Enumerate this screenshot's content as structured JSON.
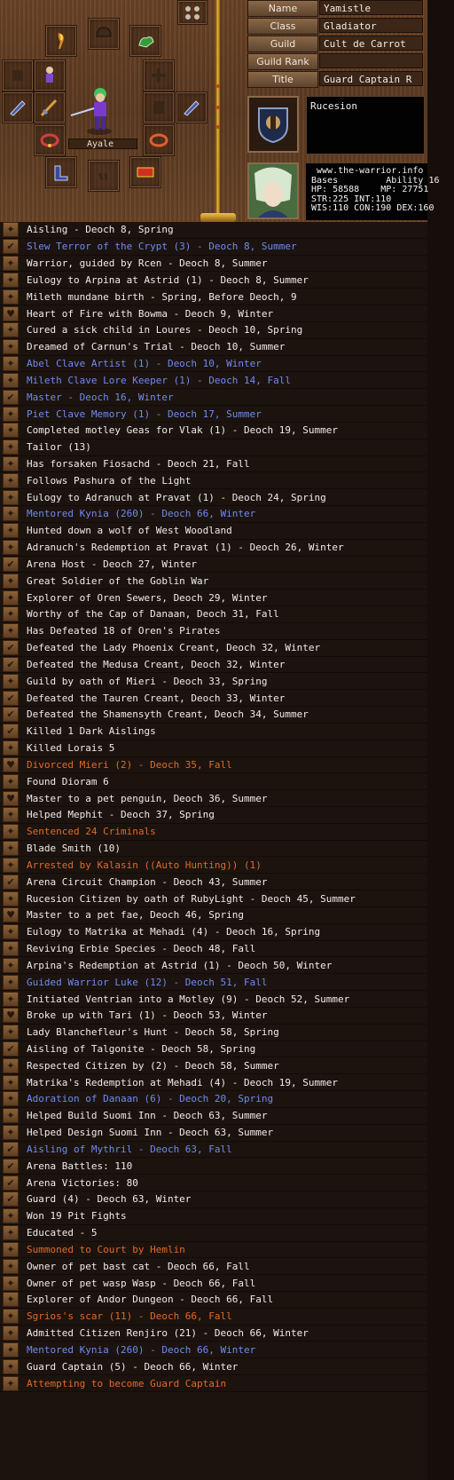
{
  "character": {
    "fields": [
      {
        "label": "Name",
        "value": "Yamistle"
      },
      {
        "label": "Class",
        "value": "Gladiator"
      },
      {
        "label": "Guild",
        "value": "Cult de Carrot"
      },
      {
        "label": "Guild Rank",
        "value": ""
      },
      {
        "label": "Title",
        "value": "Guard Captain R"
      }
    ],
    "nation": "Rucesion",
    "name_tag": "Ayale",
    "stats_lines": [
      " www.the-warrior.info",
      "Bases         Ability 16",
      "HP: 58588    MP: 27751",
      "STR:225 INT:110",
      "WIS:110 CON:190 DEX:160"
    ]
  },
  "colors": {
    "white": "#f0ece8",
    "blue": "#6e8cf0",
    "orange": "#e06a2a"
  },
  "legend": [
    {
      "mark": "wing",
      "color": "white",
      "text": "Aisling - Deoch 8, Spring"
    },
    {
      "mark": "check",
      "color": "blue",
      "text": "Slew Terror of the Crypt (3) - Deoch 8, Summer"
    },
    {
      "mark": "wing",
      "color": "white",
      "text": "Warrior, guided by Rcen - Deoch 8, Summer"
    },
    {
      "mark": "wing",
      "color": "white",
      "text": "Eulogy to Arpina at Astrid (1) - Deoch 8, Summer"
    },
    {
      "mark": "wing",
      "color": "white",
      "text": "Mileth mundane birth - Spring, Before Deoch, 9"
    },
    {
      "mark": "heart",
      "color": "white",
      "text": "Heart of Fire with Bowma - Deoch 9, Winter"
    },
    {
      "mark": "wing",
      "color": "white",
      "text": "Cured a sick child in Loures - Deoch 10, Spring"
    },
    {
      "mark": "wing",
      "color": "white",
      "text": "Dreamed of Carnun's Trial - Deoch 10, Summer"
    },
    {
      "mark": "wing",
      "color": "blue",
      "text": "Abel Clave Artist (1) - Deoch 10, Winter"
    },
    {
      "mark": "wing",
      "color": "blue",
      "text": "Mileth Clave Lore Keeper (1) - Deoch 14, Fall"
    },
    {
      "mark": "check",
      "color": "blue",
      "text": "Master - Deoch 16, Winter"
    },
    {
      "mark": "wing",
      "color": "blue",
      "text": "Piet Clave Memory (1) - Deoch 17, Summer"
    },
    {
      "mark": "wing",
      "color": "white",
      "text": "Completed motley Geas for Vlak (1) - Deoch 19, Summer"
    },
    {
      "mark": "wing",
      "color": "white",
      "text": "Tailor (13)"
    },
    {
      "mark": "wing",
      "color": "white",
      "text": "Has forsaken Fiosachd - Deoch 21, Fall"
    },
    {
      "mark": "wing",
      "color": "white",
      "text": "Follows Pashura of the Light"
    },
    {
      "mark": "wing",
      "color": "white",
      "text": "Eulogy to Adranuch at Pravat (1) - Deoch 24, Spring"
    },
    {
      "mark": "wing",
      "color": "blue",
      "text": "Mentored Kynia (260) - Deoch 66, Winter"
    },
    {
      "mark": "wing",
      "color": "white",
      "text": "Hunted down a wolf of West Woodland"
    },
    {
      "mark": "wing",
      "color": "white",
      "text": "Adranuch's Redemption at Pravat (1) - Deoch 26, Winter"
    },
    {
      "mark": "check",
      "color": "white",
      "text": "Arena Host - Deoch 27, Winter"
    },
    {
      "mark": "wing",
      "color": "white",
      "text": "Great Soldier of the Goblin War"
    },
    {
      "mark": "wing",
      "color": "white",
      "text": "Explorer of Oren Sewers, Deoch 29, Winter"
    },
    {
      "mark": "wing",
      "color": "white",
      "text": "Worthy of the Cap of Danaan, Deoch 31, Fall"
    },
    {
      "mark": "wing",
      "color": "white",
      "text": "Has Defeated 18 of Oren's Pirates"
    },
    {
      "mark": "check",
      "color": "white",
      "text": "Defeated the Lady Phoenix Creant, Deoch 32, Winter"
    },
    {
      "mark": "check",
      "color": "white",
      "text": "Defeated the Medusa Creant, Deoch 32, Winter"
    },
    {
      "mark": "wing",
      "color": "white",
      "text": "Guild by oath of Mieri - Deoch 33, Spring"
    },
    {
      "mark": "check",
      "color": "white",
      "text": "Defeated the Tauren Creant, Deoch 33, Winter"
    },
    {
      "mark": "check",
      "color": "white",
      "text": "Defeated the Shamensyth Creant, Deoch 34, Summer"
    },
    {
      "mark": "check",
      "color": "white",
      "text": "Killed 1 Dark Aislings"
    },
    {
      "mark": "wing",
      "color": "white",
      "text": "Killed Lorais 5"
    },
    {
      "mark": "heart",
      "color": "orange",
      "text": "Divorced Mieri (2) - Deoch 35, Fall"
    },
    {
      "mark": "wing",
      "color": "white",
      "text": "Found Dioram 6"
    },
    {
      "mark": "heart",
      "color": "white",
      "text": "Master to a pet penguin, Deoch 36, Summer"
    },
    {
      "mark": "wing",
      "color": "white",
      "text": "Helped Mephit - Deoch 37, Spring"
    },
    {
      "mark": "wing",
      "color": "orange",
      "text": "Sentenced 24 Criminals"
    },
    {
      "mark": "wing",
      "color": "white",
      "text": "Blade Smith (10)"
    },
    {
      "mark": "wing",
      "color": "orange",
      "text": "Arrested by Kalasin ((Auto Hunting)) (1)"
    },
    {
      "mark": "check",
      "color": "white",
      "text": "Arena Circuit Champion - Deoch 43, Summer"
    },
    {
      "mark": "wing",
      "color": "white",
      "text": "Rucesion Citizen by oath of RubyLight - Deoch 45, Summer"
    },
    {
      "mark": "heart",
      "color": "white",
      "text": "Master to a pet fae, Deoch 46, Spring"
    },
    {
      "mark": "wing",
      "color": "white",
      "text": "Eulogy to Matrika at Mehadi (4) - Deoch 16, Spring"
    },
    {
      "mark": "wing",
      "color": "white",
      "text": "Reviving Erbie Species - Deoch 48, Fall"
    },
    {
      "mark": "wing",
      "color": "white",
      "text": "Arpina's Redemption at Astrid (1) - Deoch 50, Winter"
    },
    {
      "mark": "wing",
      "color": "blue",
      "text": "Guided Warrior Luke (12) - Deoch 51, Fall"
    },
    {
      "mark": "wing",
      "color": "white",
      "text": "Initiated Ventrian into a Motley (9) - Deoch 52, Summer"
    },
    {
      "mark": "heart",
      "color": "white",
      "text": "Broke up with Tari (1) - Deoch 53, Winter"
    },
    {
      "mark": "wing",
      "color": "white",
      "text": "Lady Blanchefleur's Hunt - Deoch 58, Spring"
    },
    {
      "mark": "check",
      "color": "white",
      "text": "Aisling of Talgonite - Deoch 58, Spring"
    },
    {
      "mark": "wing",
      "color": "white",
      "text": "Respected Citizen by  (2) - Deoch 58, Summer"
    },
    {
      "mark": "wing",
      "color": "white",
      "text": "Matrika's Redemption at Mehadi (4) - Deoch 19, Summer"
    },
    {
      "mark": "wing",
      "color": "blue",
      "text": "Adoration of Danaan (6) - Deoch 20, Spring"
    },
    {
      "mark": "wing",
      "color": "white",
      "text": "Helped Build Suomi Inn - Deoch 63, Summer"
    },
    {
      "mark": "wing",
      "color": "white",
      "text": "Helped Design Suomi Inn - Deoch 63, Summer"
    },
    {
      "mark": "check",
      "color": "blue",
      "text": "Aisling of Mythril - Deoch 63, Fall"
    },
    {
      "mark": "check",
      "color": "white",
      "text": "Arena Battles: 110"
    },
    {
      "mark": "check",
      "color": "white",
      "text": "Arena Victories: 80"
    },
    {
      "mark": "check",
      "color": "white",
      "text": "Guard (4) - Deoch 63, Winter"
    },
    {
      "mark": "wing",
      "color": "white",
      "text": "Won 19 Pit Fights"
    },
    {
      "mark": "wing",
      "color": "white",
      "text": "Educated - 5"
    },
    {
      "mark": "wing",
      "color": "orange",
      "text": "Summoned to Court by Hemlin"
    },
    {
      "mark": "wing",
      "color": "white",
      "text": "Owner of pet bast cat - Deoch 66, Fall"
    },
    {
      "mark": "wing",
      "color": "white",
      "text": "Owner of pet wasp Wasp - Deoch 66, Fall"
    },
    {
      "mark": "wing",
      "color": "white",
      "text": "Explorer of Andor Dungeon - Deoch 66, Fall"
    },
    {
      "mark": "wing",
      "color": "orange",
      "text": "Sgrios's scar (11) - Deoch 66, Fall"
    },
    {
      "mark": "wing",
      "color": "white",
      "text": "Admitted Citizen Renjiro (21) - Deoch 66, Winter"
    },
    {
      "mark": "wing",
      "color": "blue",
      "text": "Mentored Kynia (260) - Deoch 66, Winter"
    },
    {
      "mark": "wing",
      "color": "white",
      "text": "Guard Captain (5) - Deoch 66, Winter"
    },
    {
      "mark": "wing",
      "color": "orange",
      "text": "Attempting to become Guard Captain"
    }
  ]
}
